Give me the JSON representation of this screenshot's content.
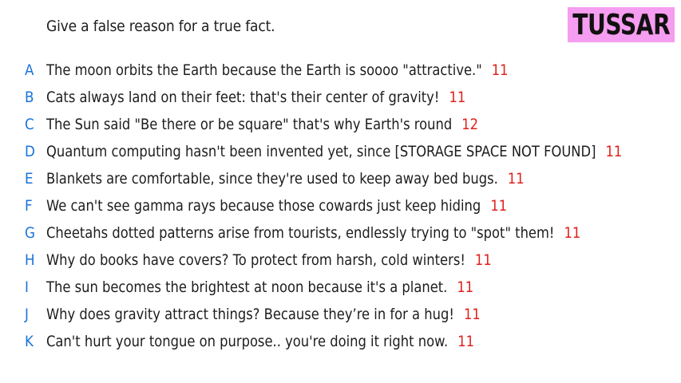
{
  "prompt": "Give a false reason for a true fact.",
  "brand": "TUSSAR",
  "colors": {
    "letter": "#1a73d9",
    "score": "#e0201b",
    "text": "#1c1c1c",
    "brand_bg": "#f59df0"
  },
  "answers": [
    {
      "letter": "A",
      "text": "The moon orbits the Earth because the Earth is soooo \"attractive.\"",
      "score": "11"
    },
    {
      "letter": "B",
      "text": "Cats always land on their feet: that's their center of gravity!",
      "score": "11"
    },
    {
      "letter": "C",
      "text": "The Sun said \"Be there or be square\" that's why Earth's round",
      "score": "12"
    },
    {
      "letter": "D",
      "text": "Quantum computing hasn't been invented yet, since [STORAGE SPACE NOT FOUND]",
      "score": "11"
    },
    {
      "letter": "E",
      "text": "Blankets are comfortable, since they're used to keep away bed bugs.",
      "score": "11"
    },
    {
      "letter": "F",
      "text": "We can't see gamma rays because those cowards just keep hiding",
      "score": "11"
    },
    {
      "letter": "G",
      "text": "Cheetahs dotted patterns arise from tourists, endlessly trying to \"spot\" them!",
      "score": "11"
    },
    {
      "letter": "H",
      "text": "Why do books have covers? To protect from harsh, cold winters!",
      "score": "11"
    },
    {
      "letter": "I",
      "text": "The sun becomes the brightest at noon because it's a planet.",
      "score": "11"
    },
    {
      "letter": "J",
      "text": "Why does gravity attract things? Because they’re in for a hug!",
      "score": "11"
    },
    {
      "letter": "K",
      "text": "Can't hurt your tongue on purpose.. you're doing it right now.",
      "score": "11"
    }
  ]
}
